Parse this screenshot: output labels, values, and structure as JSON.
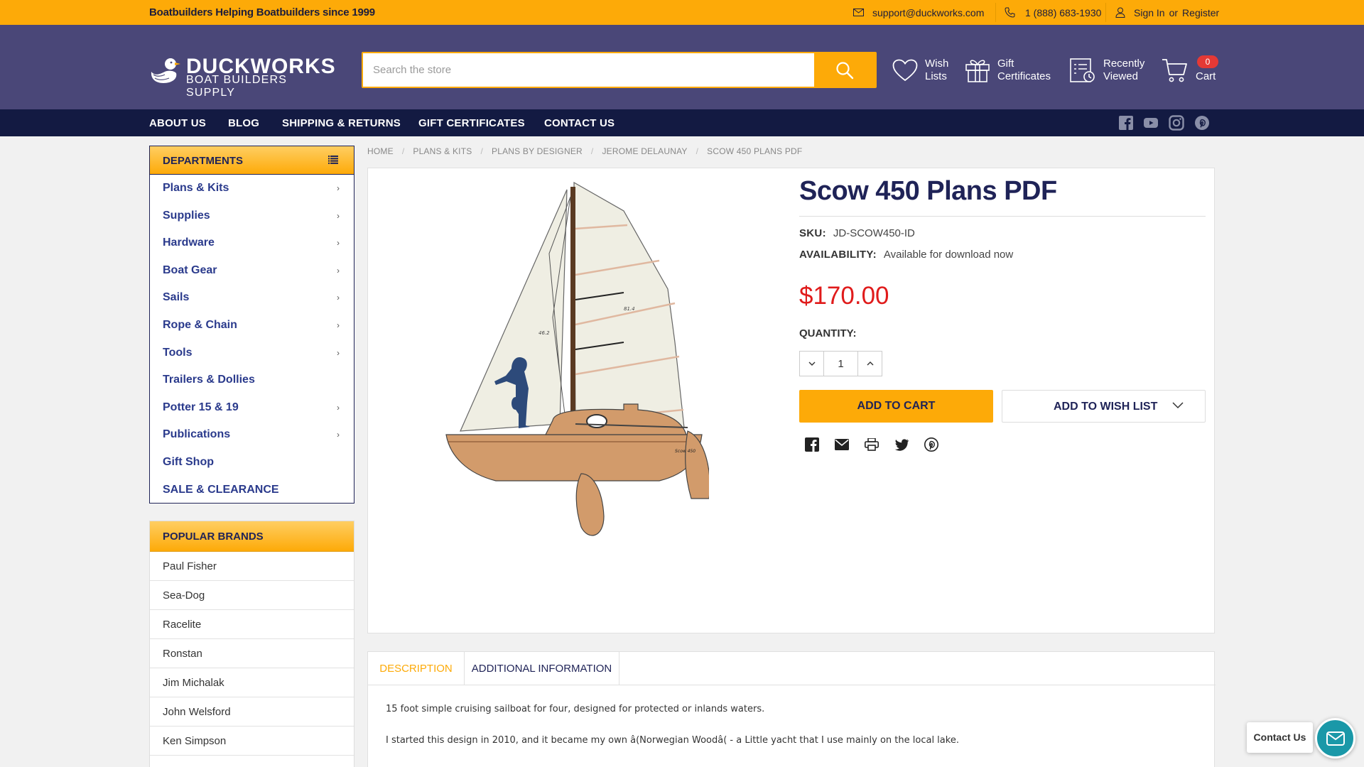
{
  "topbar": {
    "tagline": "Boatbuilders Helping Boatbuilders since 1999",
    "email": "support@duckworks.com",
    "phone": "1 (888) 683-1930",
    "sign_in": "Sign In",
    "or": "or",
    "register": "Register"
  },
  "header": {
    "logo_main": "DUCKWORKS",
    "logo_sub": "BOAT BUILDERS SUPPLY",
    "search_placeholder": "Search the store",
    "wish_lists": "Wish Lists",
    "gift_certificates": "Gift Certificates",
    "recently_viewed": "Recently Viewed",
    "cart_label": "Cart",
    "cart_count": "0"
  },
  "nav": {
    "items": [
      "ABOUT US",
      "BLOG",
      "SHIPPING & RETURNS",
      "GIFT CERTIFICATES",
      "CONTACT US"
    ]
  },
  "departments": {
    "title": "DEPARTMENTS",
    "items": [
      {
        "label": "Plans & Kits",
        "chevron": "›"
      },
      {
        "label": "Supplies",
        "chevron": "›"
      },
      {
        "label": "Hardware",
        "chevron": "›"
      },
      {
        "label": "Boat Gear",
        "chevron": "›"
      },
      {
        "label": "Sails",
        "chevron": "›"
      },
      {
        "label": "Rope & Chain",
        "chevron": "›"
      },
      {
        "label": "Tools",
        "chevron": "›"
      },
      {
        "label": "Trailers & Dollies",
        "chevron": ""
      },
      {
        "label": "Potter 15 & 19",
        "chevron": "›"
      },
      {
        "label": "Publications",
        "chevron": "›"
      },
      {
        "label": "Gift Shop",
        "chevron": ""
      },
      {
        "label": "SALE & CLEARANCE",
        "chevron": ""
      }
    ]
  },
  "brands": {
    "title": "POPULAR BRANDS",
    "items": [
      "Paul Fisher",
      "Sea-Dog",
      "Racelite",
      "Ronstan",
      "Jim Michalak",
      "John Welsford",
      "Ken Simpson"
    ]
  },
  "breadcrumb": [
    "HOME",
    "PLANS & KITS",
    "PLANS BY DESIGNER",
    "JEROME DELAUNAY",
    "SCOW 450 PLANS PDF"
  ],
  "product": {
    "title": "Scow 450 Plans PDF",
    "sku_label": "SKU:",
    "sku": "JD-SCOW450-ID",
    "availability_label": "AVAILABILITY:",
    "availability": "Available for download now",
    "price": "$170.00",
    "quantity_label": "QUANTITY:",
    "quantity": "1",
    "add_to_cart": "ADD TO CART",
    "add_to_wish_list": "ADD TO WISH LIST",
    "drawing_labels": {
      "sail_a": "81.4",
      "sail_b": "46.2",
      "hull": "Scow 450"
    }
  },
  "tabs": {
    "description": "DESCRIPTION",
    "additional": "ADDITIONAL INFORMATION"
  },
  "description": {
    "p1": "15 foot simple cruising sailboat for four, designed for protected or inlands waters.",
    "p2": "I started this design in 2010, and it became my own â(Norwegian Woodâ( - a Little yacht that I use mainly on the local lake."
  },
  "contact_widget": "Contact Us",
  "colors": {
    "accent": "#fdaa08",
    "header_bg": "#4a4778",
    "nav_bg": "#131a42",
    "title": "#1f2357",
    "price": "#e01b1b"
  }
}
